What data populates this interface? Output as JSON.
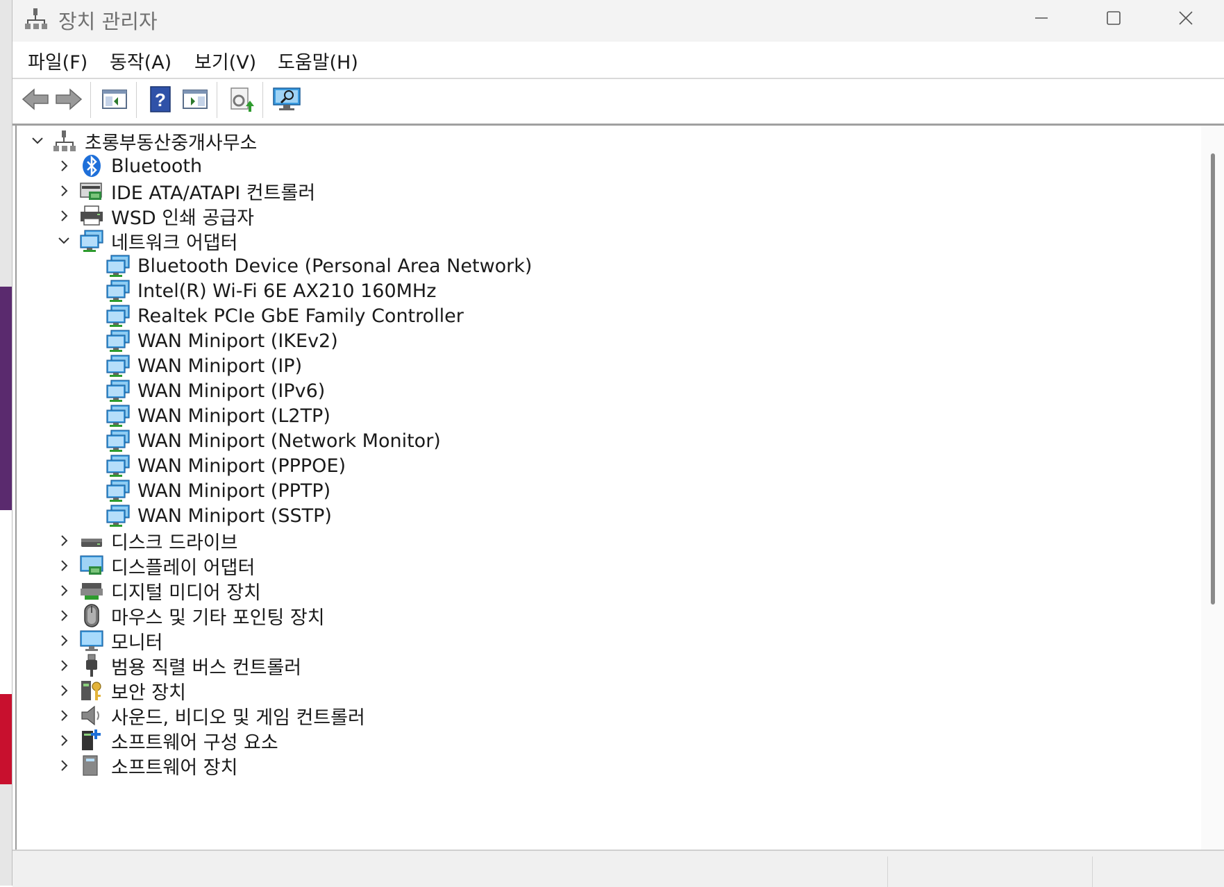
{
  "window": {
    "title": "장치 관리자",
    "controls": [
      "minimize",
      "maximize",
      "close"
    ]
  },
  "menu": [
    {
      "label": "파일(F)"
    },
    {
      "label": "동작(A)"
    },
    {
      "label": "보기(V)"
    },
    {
      "label": "도움말(H)"
    }
  ],
  "toolbar": [
    {
      "icon": "back-icon"
    },
    {
      "icon": "forward-icon"
    },
    {
      "icon": "show-hide-console-tree-icon"
    },
    {
      "icon": "help-icon"
    },
    {
      "icon": "action-pane-icon"
    },
    {
      "icon": "update-driver-icon"
    },
    {
      "icon": "scan-hardware-icon"
    }
  ],
  "tree": {
    "root": {
      "label": "초롱부동산중개사무소",
      "icon": "computer-icon",
      "expanded": true
    },
    "categories": [
      {
        "label": "Bluetooth",
        "icon": "bluetooth-icon",
        "expanded": false
      },
      {
        "label": "IDE ATA/ATAPI 컨트롤러",
        "icon": "ide-controller-icon",
        "expanded": false
      },
      {
        "label": "WSD 인쇄 공급자",
        "icon": "printer-icon",
        "expanded": false
      },
      {
        "label": "네트워크 어댑터",
        "icon": "network-adapter-icon",
        "expanded": true,
        "children": [
          {
            "label": "Bluetooth Device (Personal Area Network)"
          },
          {
            "label": "Intel(R) Wi-Fi 6E AX210 160MHz"
          },
          {
            "label": "Realtek PCIe GbE Family Controller"
          },
          {
            "label": "WAN Miniport (IKEv2)"
          },
          {
            "label": "WAN Miniport (IP)"
          },
          {
            "label": "WAN Miniport (IPv6)"
          },
          {
            "label": "WAN Miniport (L2TP)"
          },
          {
            "label": "WAN Miniport (Network Monitor)"
          },
          {
            "label": "WAN Miniport (PPPOE)"
          },
          {
            "label": "WAN Miniport (PPTP)"
          },
          {
            "label": "WAN Miniport (SSTP)"
          }
        ]
      },
      {
        "label": "디스크 드라이브",
        "icon": "disk-drive-icon",
        "expanded": false
      },
      {
        "label": "디스플레이 어댑터",
        "icon": "display-adapter-icon",
        "expanded": false
      },
      {
        "label": "디지털 미디어 장치",
        "icon": "digital-media-icon",
        "expanded": false
      },
      {
        "label": "마우스 및 기타 포인팅 장치",
        "icon": "mouse-icon",
        "expanded": false
      },
      {
        "label": "모니터",
        "icon": "monitor-icon",
        "expanded": false
      },
      {
        "label": "범용 직렬 버스 컨트롤러",
        "icon": "usb-icon",
        "expanded": false
      },
      {
        "label": "보안 장치",
        "icon": "security-device-icon",
        "expanded": false
      },
      {
        "label": "사운드, 비디오 및 게임 컨트롤러",
        "icon": "speaker-icon",
        "expanded": false
      },
      {
        "label": "소프트웨어 구성 요소",
        "icon": "software-component-icon",
        "expanded": false
      },
      {
        "label": "소프트웨어 장치",
        "icon": "software-device-icon",
        "expanded": false
      }
    ]
  },
  "colors": {
    "titlebar": "#f3f3f3",
    "network_blue": "#3a9be0",
    "bluetooth_blue": "#1e6fd9"
  }
}
